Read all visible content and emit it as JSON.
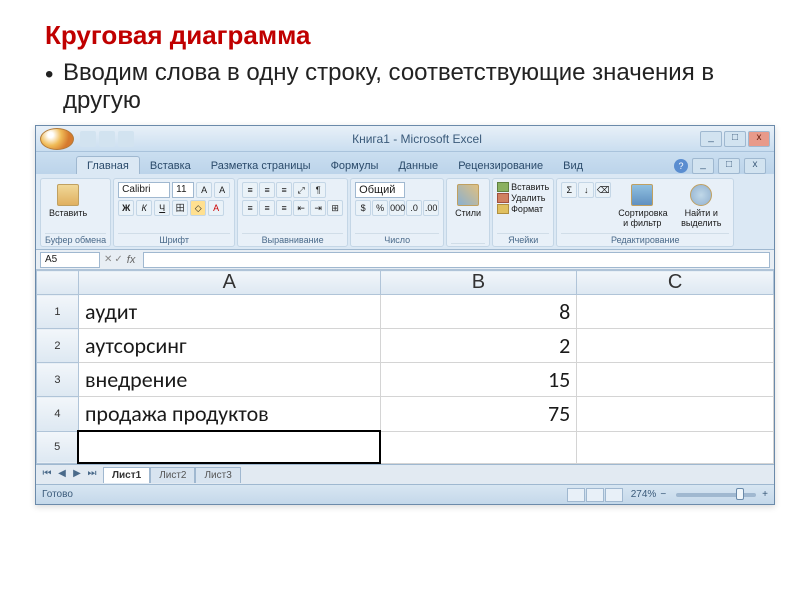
{
  "slide": {
    "title": "Круговая диаграмма",
    "bullet": "Вводим слова в одну строку, соответствующие значения в другую"
  },
  "window": {
    "title": "Книга1 - Microsoft Excel"
  },
  "tabs": [
    "Главная",
    "Вставка",
    "Разметка страницы",
    "Формулы",
    "Данные",
    "Рецензирование",
    "Вид"
  ],
  "ribbon": {
    "paste": "Вставить",
    "clipboard": "Буфер обмена",
    "font_name": "Calibri",
    "font_size": "11",
    "font": "Шрифт",
    "alignment": "Выравнивание",
    "number_fmt": "Общий",
    "number": "Число",
    "styles": "Стили",
    "insert": "Вставить",
    "delete": "Удалить",
    "format": "Формат",
    "cells": "Ячейки",
    "sort": "Сортировка и фильтр",
    "find": "Найти и выделить",
    "editing": "Редактирование"
  },
  "namebox": "A5",
  "columns": [
    "A",
    "B",
    "C"
  ],
  "rows": [
    {
      "n": "1",
      "a": "аудит",
      "b": "8"
    },
    {
      "n": "2",
      "a": "аутсорсинг",
      "b": "2"
    },
    {
      "n": "3",
      "a": "внедрение",
      "b": "15"
    },
    {
      "n": "4",
      "a": "продажа продуктов",
      "b": "75"
    },
    {
      "n": "5",
      "a": "",
      "b": ""
    }
  ],
  "sheets": [
    "Лист1",
    "Лист2",
    "Лист3"
  ],
  "status": {
    "ready": "Готово",
    "zoom": "274%"
  },
  "chart_data": {
    "type": "table",
    "title": "Круговая диаграмма",
    "categories": [
      "аудит",
      "аутсорсинг",
      "внедрение",
      "продажа продуктов"
    ],
    "values": [
      8,
      2,
      15,
      75
    ]
  }
}
